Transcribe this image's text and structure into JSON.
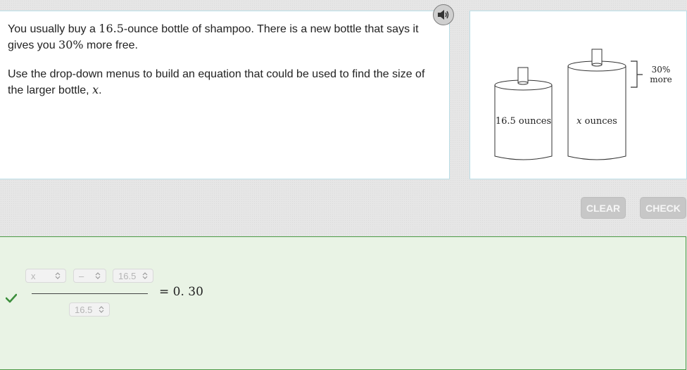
{
  "question": {
    "p1": {
      "before": "You usually buy a ",
      "num1": "16.5",
      "middle": "-ounce bottle of shampoo. There is a new bottle that says it gives you ",
      "num2": "30%",
      "after": " more free."
    },
    "p2": {
      "before": "Use the drop-down menus to build an equation that could be used to find the size of the larger bottle, ",
      "var": "x",
      "after": "."
    }
  },
  "figure": {
    "small_bottle_label": "16.5 ounces",
    "large_bottle_var": "x",
    "large_bottle_unit": " ounces",
    "bracket_label_line1": "30%",
    "bracket_label_line2": "more"
  },
  "buttons": {
    "clear": "CLEAR",
    "check": "CHECK"
  },
  "equation": {
    "numerator": {
      "dropdown1": "x",
      "dropdown2": "–",
      "dropdown3": "16.5"
    },
    "denominator": {
      "dropdown1": "16.5"
    },
    "rhs": "= 0. 30"
  },
  "icons": {
    "audio": "speaker-icon",
    "status": "check-mark-icon",
    "select": "chevron-updown-icon"
  },
  "colors": {
    "answer_bg": "#e9f3e5",
    "answer_border": "#4b9a45",
    "check": "#3c8e3c",
    "button_disabled": "#c7c7c7"
  }
}
